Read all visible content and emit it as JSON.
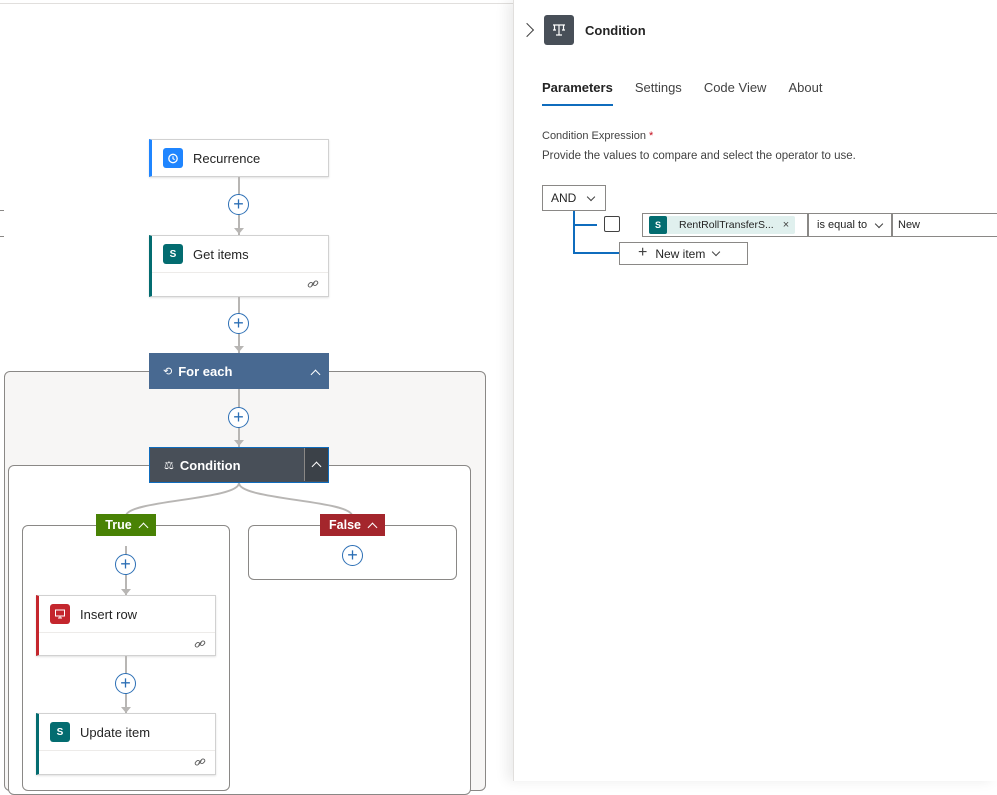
{
  "canvas": {
    "recurrence": {
      "label": "Recurrence",
      "color": "#1f85ff"
    },
    "get_items": {
      "label": "Get items",
      "icon": "sharepoint-icon",
      "color": "#036c70"
    },
    "for_each": {
      "label": "For each",
      "color": "#486991"
    },
    "condition": {
      "label": "Condition",
      "color": "#484f58"
    },
    "true_branch": {
      "label": "True",
      "color": "#498205"
    },
    "false_branch": {
      "label": "False",
      "color": "#a4262c"
    },
    "insert_row": {
      "label": "Insert row",
      "icon": "sql-server-icon",
      "color": "#c4262d"
    },
    "update_item": {
      "label": "Update item",
      "icon": "sharepoint-icon",
      "color": "#036c70"
    }
  },
  "panel": {
    "title": "Condition",
    "tabs": [
      {
        "label": "Parameters",
        "active": true
      },
      {
        "label": "Settings",
        "active": false
      },
      {
        "label": "Code View",
        "active": false
      },
      {
        "label": "About",
        "active": false
      }
    ],
    "expression_label": "Condition Expression",
    "required_mark": "*",
    "description": "Provide the values to compare and select the operator to use.",
    "group_operator": "AND",
    "row": {
      "token_text": "RentRollTransferS...",
      "token_close": "×",
      "operator": "is equal to",
      "value": "New"
    },
    "new_item_label": "New item"
  }
}
